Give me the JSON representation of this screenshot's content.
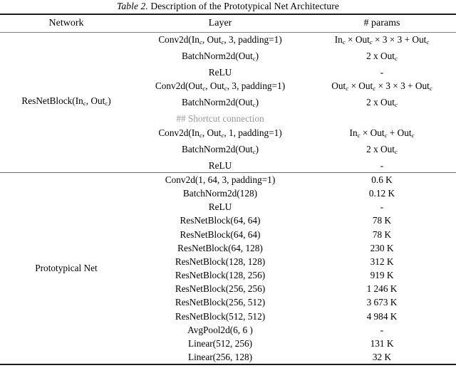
{
  "caption": {
    "label": "Table 2.",
    "text": "Description of the Prototypical Net Architecture"
  },
  "header": {
    "network": "Network",
    "layer": "Layer",
    "params": "# params"
  },
  "sections": [
    {
      "network": "ResNetBlock(Inᴄ, Outᴄ)",
      "network_parts": {
        "prefix": "ResNetBlock(In",
        "sub1": "c",
        "mid": ", Out",
        "sub2": "c",
        "suffix": ")"
      },
      "rows": [
        {
          "layer": "Conv2d(Inₑ, Outₑ, 3, padding=1)",
          "params": "Inₑ × Outₑ × 3 × 3 + Outₑ",
          "style": "normal"
        },
        {
          "layer": "BatchNorm2d(Outₑ)",
          "params": "2 x Outₑ",
          "style": "normal"
        },
        {
          "layer": "ReLU",
          "params": "-",
          "style": "normal"
        },
        {
          "layer": "Conv2d(Outₑ, Outₑ, 3, padding=1)",
          "params": "Outₑ × Outₑ × 3 × 3 + Outₑ",
          "style": "normal"
        },
        {
          "layer": "BatchNorm2d(Outₑ)",
          "params": "2 x Outₑ",
          "style": "normal"
        },
        {
          "layer": "## Shortcut connection",
          "params": "",
          "style": "comment"
        },
        {
          "layer": "Conv2d(Inₑ, Outₑ, 1, padding=1)",
          "params": "Inₑ × Outₑ + Outₑ",
          "style": "normal"
        },
        {
          "layer": "BatchNorm2d(Outₑ)",
          "params": "2 x Outₑ",
          "style": "normal"
        },
        {
          "layer": "ReLU",
          "params": "-",
          "style": "normal"
        }
      ]
    },
    {
      "network": "Prototypical Net",
      "rows": [
        {
          "layer": "Conv2d(1, 64, 3, padding=1)",
          "params": "0.6 K",
          "style": "normal"
        },
        {
          "layer": "BatchNorm2d(128)",
          "params": "0.12 K",
          "style": "normal"
        },
        {
          "layer": "ReLU",
          "params": "-",
          "style": "normal"
        },
        {
          "layer": "ResNetBlock(64, 64)",
          "params": "78 K",
          "style": "normal"
        },
        {
          "layer": "ResNetBlock(64, 64)",
          "params": "78 K",
          "style": "normal"
        },
        {
          "layer": "ResNetBlock(64, 128)",
          "params": "230 K",
          "style": "normal"
        },
        {
          "layer": "ResNetBlock(128, 128)",
          "params": "312 K",
          "style": "normal"
        },
        {
          "layer": "ResNetBlock(128, 256)",
          "params": "919 K",
          "style": "normal"
        },
        {
          "layer": "ResNetBlock(256, 256)",
          "params": "1 246 K",
          "style": "normal"
        },
        {
          "layer": "ResNetBlock(256, 512)",
          "params": "3 673 K",
          "style": "normal"
        },
        {
          "layer": "ResNetBlock(512, 512)",
          "params": "4 984 K",
          "style": "normal"
        },
        {
          "layer": "AvgPool2d(6, 6 )",
          "params": "-",
          "style": "normal"
        },
        {
          "layer": "Linear(512, 256)",
          "params": "131 K",
          "style": "normal"
        },
        {
          "layer": "Linear(256, 128)",
          "params": "32 K",
          "style": "normal"
        }
      ]
    }
  ],
  "colors": {
    "rule_dark": "#1a1a1a",
    "rule_light": "#7d7d7d",
    "comment_gray": "#9a9a9a",
    "text": "#000000"
  }
}
